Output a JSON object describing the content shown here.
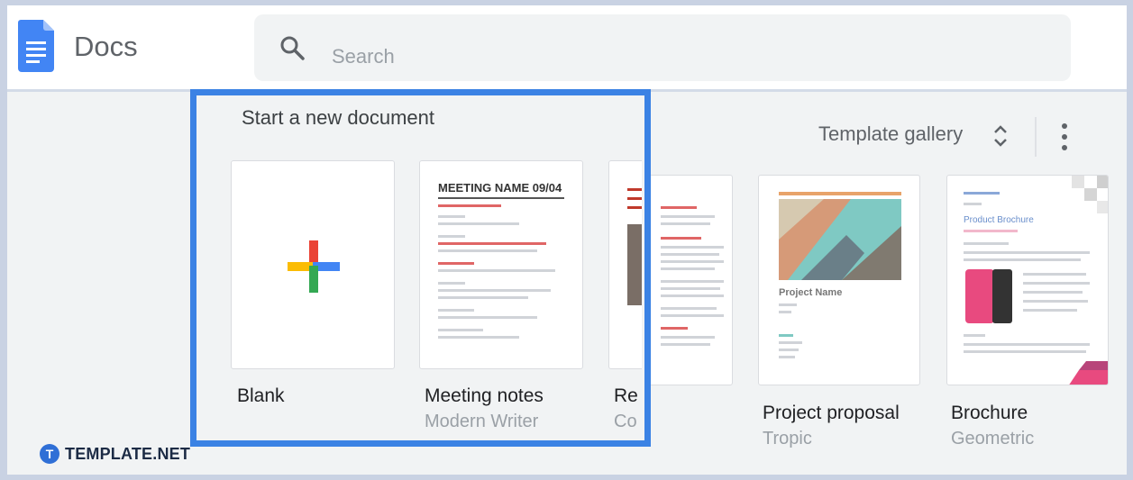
{
  "app": {
    "title": "Docs"
  },
  "search": {
    "placeholder": "Search"
  },
  "section": {
    "title": "Start a new document"
  },
  "toolbar": {
    "template_gallery_label": "Template gallery"
  },
  "templates": [
    {
      "name": "Blank",
      "subtitle": ""
    },
    {
      "name": "Meeting notes",
      "subtitle": "Modern Writer",
      "preview_heading": "MEETING NAME 09/04"
    },
    {
      "name": "Re",
      "subtitle": "Co"
    },
    {
      "name": "Project proposal",
      "subtitle": "Tropic",
      "preview_heading": "Project Name"
    },
    {
      "name": "Brochure",
      "subtitle": "Geometric",
      "preview_heading": "Product Brochure"
    }
  ],
  "watermark": {
    "brand": "TEMPLATE.NET",
    "letter": "T"
  },
  "colors": {
    "highlight": "#3b82e4",
    "docs_blue": "#4285f4",
    "plus_red": "#ea4335",
    "plus_yellow": "#fbbc04",
    "plus_green": "#34a853",
    "plus_blue": "#4285f4"
  },
  "icons": [
    "docs-logo-icon",
    "search-icon",
    "sort-arrows-icon",
    "more-vert-icon",
    "plus-icon"
  ]
}
